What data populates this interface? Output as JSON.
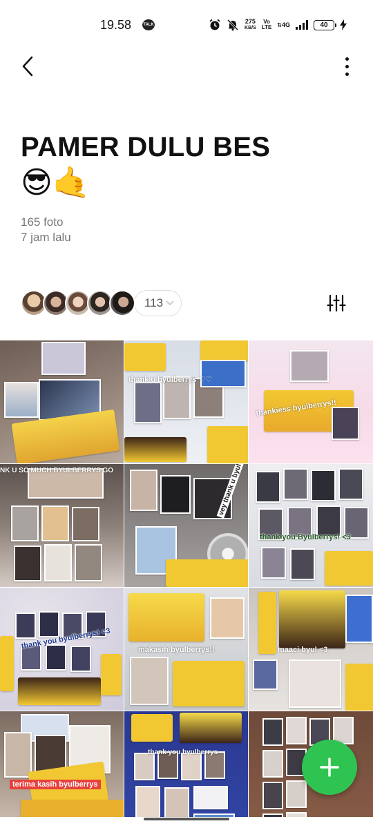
{
  "status_bar": {
    "time": "19.58",
    "talk_badge": "TALK",
    "speed_value": "275",
    "speed_unit": "KB/S",
    "volte_top": "Vo",
    "volte_bottom": "LTE",
    "network": "4G",
    "battery": "40"
  },
  "header": {
    "back_icon": "chevron-left-icon",
    "more_icon": "more-vertical-icon"
  },
  "album": {
    "title": "PAMER DULU BES",
    "emoji": "😎🤙",
    "photo_count": "165 foto",
    "updated": "7 jam lalu"
  },
  "members": {
    "count": "113"
  },
  "photos": [
    {
      "caption": ""
    },
    {
      "caption": "thank u byulberrys ♡♡"
    },
    {
      "caption": "thankiess byulberrys!!"
    },
    {
      "caption": "NK U SO MUCH BYULBERRYS GO"
    },
    {
      "caption": "vey thank u byul!"
    },
    {
      "caption": "thank you Byulberrys! <3"
    },
    {
      "caption": "thank you byulberrys! <3"
    },
    {
      "caption": "makasih byulberrys!!"
    },
    {
      "caption": "maaci byul <3"
    },
    {
      "caption": "terima kasih byulberrys"
    },
    {
      "caption": "thank you byulberrys"
    },
    {
      "caption": ""
    }
  ],
  "colors": {
    "fab": "#2fc452",
    "title": "#111111",
    "meta": "#777777"
  }
}
